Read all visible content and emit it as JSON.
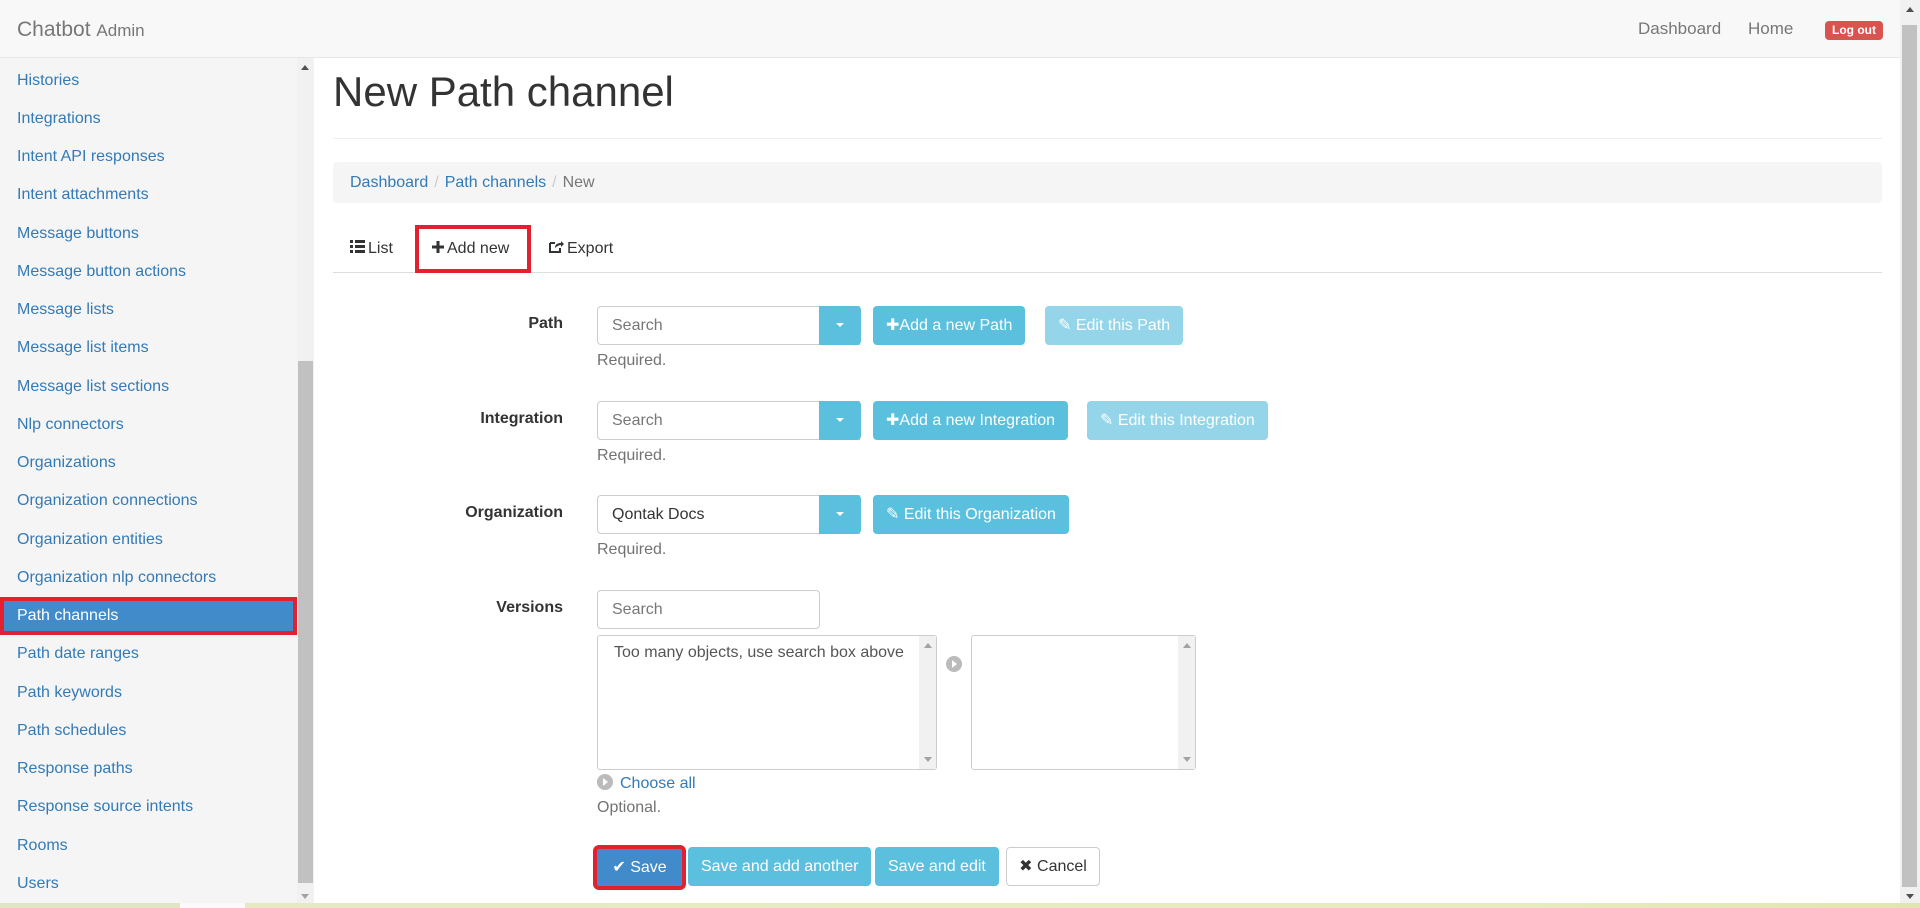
{
  "navbar": {
    "brand": "Chatbot",
    "brand_sub": "Admin",
    "links": [
      "Dashboard",
      "Home"
    ],
    "logout": "Log out"
  },
  "sidebar": {
    "items": [
      "Histories",
      "Integrations",
      "Intent API responses",
      "Intent attachments",
      "Message buttons",
      "Message button actions",
      "Message lists",
      "Message list items",
      "Message list sections",
      "Nlp connectors",
      "Organizations",
      "Organization connections",
      "Organization entities",
      "Organization nlp connectors",
      "Path channels",
      "Path date ranges",
      "Path keywords",
      "Path schedules",
      "Response paths",
      "Response source intents",
      "Rooms",
      "Users"
    ],
    "active": "Path channels"
  },
  "page": {
    "title": "New Path channel",
    "breadcrumb": [
      "Dashboard",
      "Path channels",
      "New"
    ],
    "tabs": [
      "List",
      "Add new",
      "Export"
    ]
  },
  "form": {
    "path": {
      "label": "Path",
      "placeholder": "Search",
      "add_button": "Add a new Path",
      "edit_button": "Edit this Path",
      "help": "Required."
    },
    "integration": {
      "label": "Integration",
      "placeholder": "Search",
      "add_button": "Add a new Integration",
      "edit_button": "Edit this Integration",
      "help": "Required."
    },
    "organization": {
      "label": "Organization",
      "value": "Qontak Docs",
      "edit_button": "Edit this Organization",
      "help": "Required."
    },
    "versions": {
      "label": "Versions",
      "placeholder": "Search",
      "available_text": "Too many objects, use search box above",
      "choose_all": "Choose all",
      "help": "Optional."
    }
  },
  "actions": {
    "save": "Save",
    "save_add": "Save and add another",
    "save_edit": "Save and edit",
    "cancel": "Cancel"
  },
  "colors": {
    "primary": "#428bca",
    "info": "#5bc0de",
    "danger": "#d9534f",
    "highlight": "#e3202f",
    "link": "#337ab7"
  }
}
